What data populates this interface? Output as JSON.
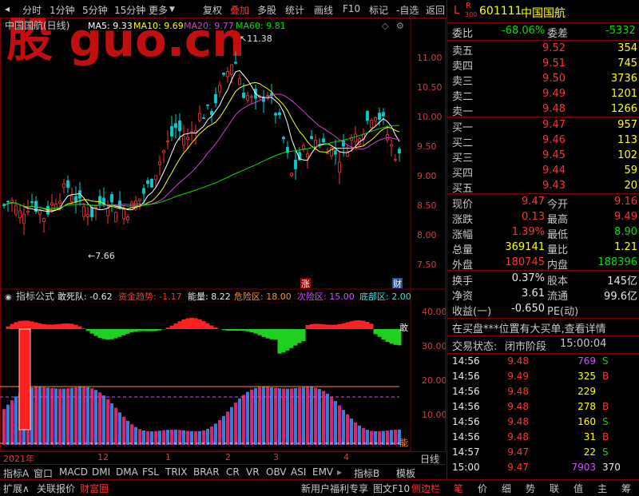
{
  "toolbar": {
    "left": [
      "分时",
      "1分钟",
      "5分钟",
      "15分钟",
      "更多"
    ],
    "right": [
      "复权",
      "叠加",
      "多股",
      "统计",
      "画线",
      "F10",
      "标记",
      "-自选",
      "返回"
    ],
    "active": "叠加"
  },
  "chart_title": "中国国航(日线)",
  "ma_labels": {
    "ma5": "MA5: 9.33",
    "ma10": "MA10: 9.69",
    "ma20": "MA20: 9.77",
    "ma60": "MA60: 9.81"
  },
  "watermark": "股 guo.cn",
  "price_axis": [
    "11.00",
    "10.50",
    "10.00",
    "9.50",
    "9.00",
    "8.50",
    "8.00",
    "7.50"
  ],
  "price_high_mark": "11.38",
  "price_low_mark": "7.66",
  "markers": {
    "zhang": "涨",
    "cai": "财"
  },
  "indicator": {
    "name": "指标公式",
    "dsd": "敢死队: -0.62",
    "zjqs": "资金趋势: -1.17",
    "nl": "能量: 8.22",
    "wxq": "危险区: 18.00",
    "lsq": "次险区: 15.00",
    "dbq": "底部区: 2.00",
    "side_label": "敢",
    "side_label2": "能"
  },
  "ind_axis": [
    "40.00",
    "30.00",
    "20.00",
    "10.00"
  ],
  "date_axis": {
    "year": "2021年",
    "m12": "12",
    "m1": "1",
    "m2": "2",
    "m3": "3",
    "m4": "4",
    "period": "日线"
  },
  "tabs1": [
    "指标A",
    "窗口",
    "MACD",
    "DMI",
    "DMA",
    "FSL",
    "TRIX",
    "BRAR",
    "CR",
    "VR",
    "OBV",
    "ASI",
    "EMV",
    "指标B",
    "模板"
  ],
  "tabs2": {
    "left": [
      "扩展∧",
      "关联报价",
      "财富圈"
    ],
    "mid": [
      "新用户福利专享",
      "图文F10",
      "侧边栏"
    ],
    "right": [
      "笔",
      "价",
      "细",
      "势",
      "联",
      "值",
      "主",
      "筹"
    ]
  },
  "stock": {
    "L": "L",
    "R": "R",
    "R_num": "300",
    "code": "601111",
    "name": "中国国航"
  },
  "weibi": {
    "label": "委比",
    "value": "-68.06%",
    "label2": "委差",
    "value2": "-5332"
  },
  "asks": [
    {
      "label": "卖五",
      "price": "9.52",
      "vol": "354"
    },
    {
      "label": "卖四",
      "price": "9.51",
      "vol": "745"
    },
    {
      "label": "卖三",
      "price": "9.50",
      "vol": "3736"
    },
    {
      "label": "卖二",
      "price": "9.49",
      "vol": "1201"
    },
    {
      "label": "卖一",
      "price": "9.48",
      "vol": "1266"
    }
  ],
  "bids": [
    {
      "label": "买一",
      "price": "9.47",
      "vol": "957"
    },
    {
      "label": "买二",
      "price": "9.46",
      "vol": "113"
    },
    {
      "label": "买三",
      "price": "9.45",
      "vol": "102"
    },
    {
      "label": "买四",
      "price": "9.44",
      "vol": "59"
    },
    {
      "label": "买五",
      "price": "9.43",
      "vol": "20"
    }
  ],
  "quote": [
    {
      "l1": "现价",
      "v1": "9.47",
      "l2": "今开",
      "v2": "9.16"
    },
    {
      "l1": "涨跌",
      "v1": "0.13",
      "l2": "最高",
      "v2": "9.49"
    },
    {
      "l1": "涨幅",
      "v1": "1.39%",
      "l2": "最低",
      "v2": "8.90"
    },
    {
      "l1": "总量",
      "v1": "369141",
      "l2": "量比",
      "v2": "1.21"
    },
    {
      "l1": "外盘",
      "v1": "180745",
      "l2": "内盘",
      "v2": "188396"
    }
  ],
  "stats": [
    {
      "l1": "换手",
      "v1": "0.37%",
      "l2": "股本",
      "v2": "145亿"
    },
    {
      "l1": "净资",
      "v1": "3.61",
      "l2": "流通",
      "v2": "99.6亿"
    },
    {
      "l1": "收益(一)",
      "v1": "-0.650",
      "l2": "PE(动)",
      "v2": ""
    }
  ],
  "notice": "在买盘***位置有大买单,查看详情",
  "trade_status": {
    "label": "交易状态:",
    "value": "闭市阶段",
    "time": "15:00:04"
  },
  "ticks": [
    {
      "time": "14:56",
      "price": "9.48",
      "vol": "769",
      "bs": "S"
    },
    {
      "time": "14:56",
      "price": "9.49",
      "vol": "325",
      "bs": "B"
    },
    {
      "time": "14:56",
      "price": "9.48",
      "vol": "229",
      "bs": ""
    },
    {
      "time": "14:56",
      "price": "9.48",
      "vol": "278",
      "bs": "B"
    },
    {
      "time": "14:56",
      "price": "9.48",
      "vol": "160",
      "bs": "S"
    },
    {
      "time": "14:56",
      "price": "9.48",
      "vol": "31",
      "bs": "B"
    },
    {
      "time": "14:57",
      "price": "9.47",
      "vol": "22",
      "bs": "S"
    },
    {
      "time": "15:00",
      "price": "9.47",
      "vol": "7903",
      "bs": "370"
    }
  ],
  "colors": {
    "up": "#ff3232",
    "down": "#00d0d0",
    "ma5": "#ffffff",
    "ma10": "#ffff00",
    "ma20": "#d040d0",
    "ma60": "#00e000",
    "border": "#7a0000"
  }
}
